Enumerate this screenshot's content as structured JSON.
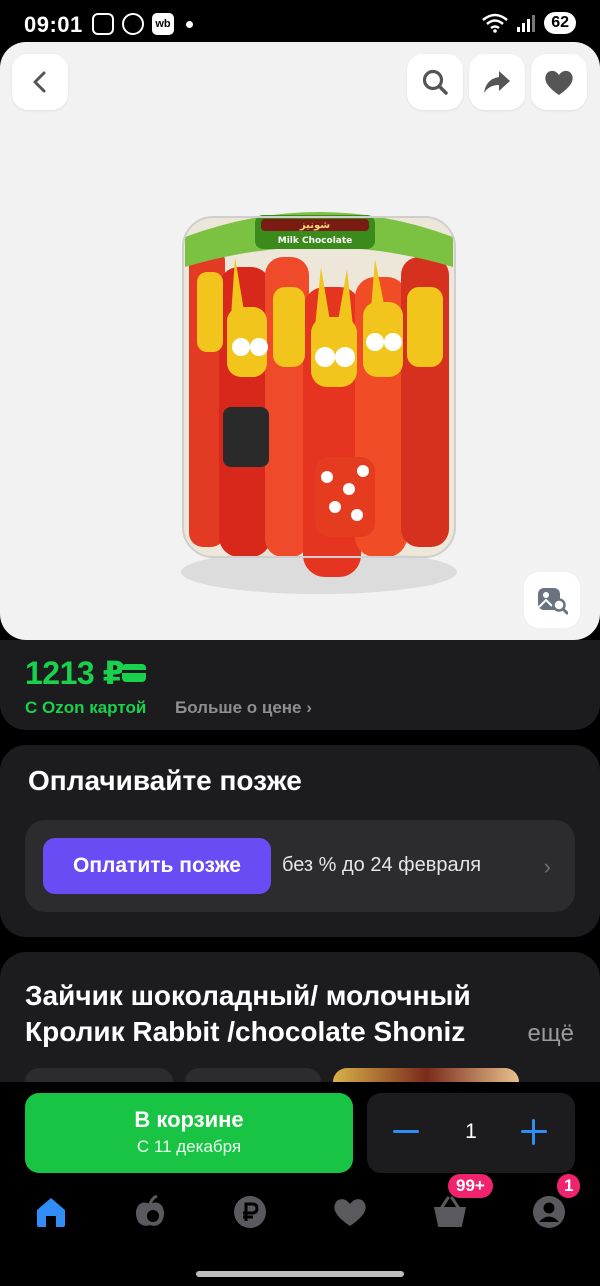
{
  "status_bar": {
    "time": "09:01",
    "battery": "62",
    "wb_badge": "wb"
  },
  "product_image": {
    "label_top": "Milk Chocolate",
    "brand_label": "شونيز"
  },
  "price": {
    "value": "1213 ₽",
    "ozon_card": "С Ozon картой",
    "more": "Больше о цене ›"
  },
  "pay_later": {
    "title": "Оплачивайте позже",
    "button": "Оплатить позже",
    "note": "без % до 24 февраля",
    "chevron": "›"
  },
  "product_title": {
    "line1": "Зайчик шоколадный/ молочный",
    "line2": "Кролик Rabbit /chocolate Shoniz",
    "more": "ещё"
  },
  "cart": {
    "label": "В корзине",
    "date": "С 11 декабря",
    "quantity": "1"
  },
  "nav": {
    "cart_badge": "99+",
    "profile_badge": "1"
  },
  "colors": {
    "accent_green": "#19d14d",
    "pay_purple": "#6a4cf4",
    "nav_blue": "#2f8df5",
    "badge_pink": "#f0246e"
  }
}
